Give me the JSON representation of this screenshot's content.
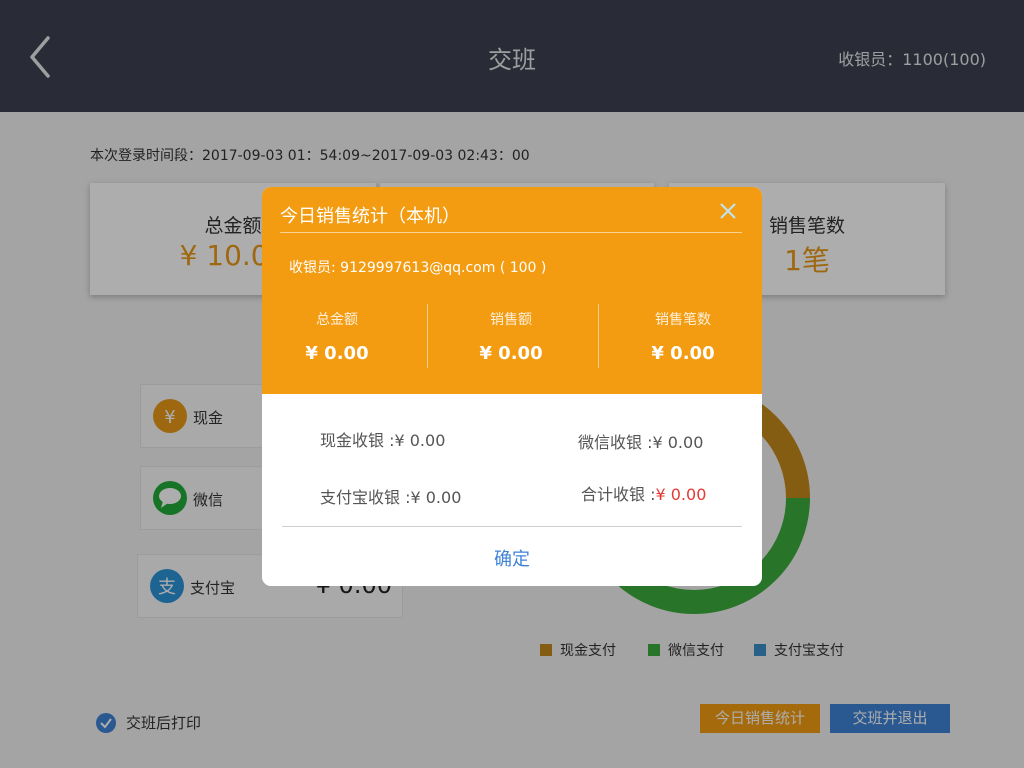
{
  "header": {
    "title": "交班",
    "cashier": "收银员：1100(100)"
  },
  "session": {
    "time_range": "本次登录时间段：2017-09-03 01：54:09~2017-09-03 02:43：00"
  },
  "summary": [
    {
      "label": "总金额",
      "value": "¥ 10.00"
    },
    {
      "label": "",
      "value": ""
    },
    {
      "label": "销售笔数",
      "value": "1笔"
    }
  ],
  "payments": [
    {
      "name": "现金",
      "amount": "",
      "icon": "cash-icon",
      "color": "#e99a1a"
    },
    {
      "name": "微信",
      "amount": "",
      "icon": "wechat-icon",
      "color": "#22ac38"
    },
    {
      "name": "支付宝",
      "amount": "¥ 0.00",
      "icon": "alipay-icon",
      "color": "#2d94d8"
    }
  ],
  "chart_data": {
    "type": "pie",
    "categories": [
      "现金支付",
      "微信支付",
      "支付宝支付"
    ],
    "values": [
      0.25,
      0.75,
      0
    ],
    "colors": [
      "#c5891b",
      "#3cab3b",
      "#3a8fc9"
    ]
  },
  "legend": [
    "现金支付",
    "微信支付",
    "支付宝支付"
  ],
  "footer": {
    "print_after": "交班后打印",
    "stats_button": "今日销售统计",
    "exit_button": "交班并退出"
  },
  "dialog": {
    "title": "今日销售统计（本机）",
    "cashier": "收银员:   9129997613@qq.com ( 100 )",
    "stats": [
      {
        "label": "总金额",
        "value": "¥ 0.00"
      },
      {
        "label": "销售额",
        "value": "¥ 0.00"
      },
      {
        "label": "销售笔数",
        "value": "¥ 0.00"
      }
    ],
    "cash_label": "现金收银 :",
    "cash_value": "¥ 0.00",
    "wechat_label": "微信收银 :",
    "wechat_value": "¥ 0.00",
    "alipay_label": "支付宝收银 :",
    "alipay_value": "¥ 0.00",
    "total_label": "合计收银 :",
    "total_value": "¥ 0.00",
    "confirm": "确定"
  },
  "colors": {
    "header_bg": "#3d4250",
    "accent_orange": "#f39c12",
    "accent_blue": "#3f83d8",
    "total_red": "#e53935"
  }
}
